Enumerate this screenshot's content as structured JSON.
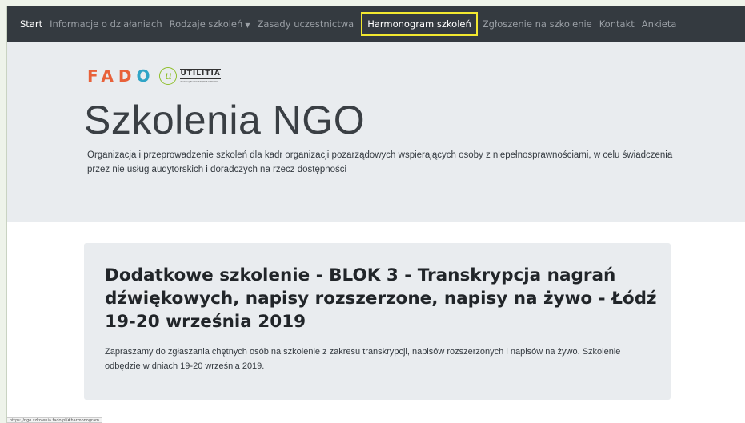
{
  "nav": {
    "items": [
      {
        "label": "Start",
        "state": "active"
      },
      {
        "label": "Informacje o działaniach",
        "state": ""
      },
      {
        "label": "Rodzaje szkoleń",
        "state": "",
        "dropdown": true
      },
      {
        "label": "Zasady uczestnictwa",
        "state": ""
      },
      {
        "label": "Harmonogram szkoleń",
        "state": "focused"
      },
      {
        "label": "Zgłoszenie na szkolenie",
        "state": ""
      },
      {
        "label": "Kontakt",
        "state": ""
      },
      {
        "label": "Ankieta",
        "state": ""
      }
    ]
  },
  "logos": {
    "fado": "FADO",
    "utilitia_mark": "u",
    "utilitia_name": "UTILITIA",
    "utilitia_sub": "POZNAJ NA DOSTĘPNE STRONY"
  },
  "hero": {
    "title": "Szkolenia NGO",
    "lead": "Organizacja i przeprowadzenie szkoleń dla kadr organizacji pozarządowych wspierających osoby z niepełnosprawnościami, w celu świadczenia przez nie usług audytorskich i doradczych na rzecz dostępności"
  },
  "card": {
    "title": "Dodatkowe szkolenie - BLOK 3 - Transkrypcja nagrań dźwiękowych, napisy rozszerzone, napisy na żywo - Łódź 19-20 września 2019",
    "text": "Zapraszamy do zgłaszania chętnych osób na szkolenie z zakresu transkrypcji, napisów rozszerzonych i napisów na żywo. Szkolenie odbędzie w dniach 19-20 września 2019."
  },
  "status_bar": {
    "url": "https://ngo.szkolenia.fado.pl/#harmonogram"
  },
  "colors": {
    "navbar": "#343a40",
    "focus_outline": "#f2e830",
    "jumbotron": "#e9ecef",
    "fado_orange": "#e8613a",
    "fado_blue": "#2fa4c6",
    "utilitia_green": "#8fbf2b"
  }
}
